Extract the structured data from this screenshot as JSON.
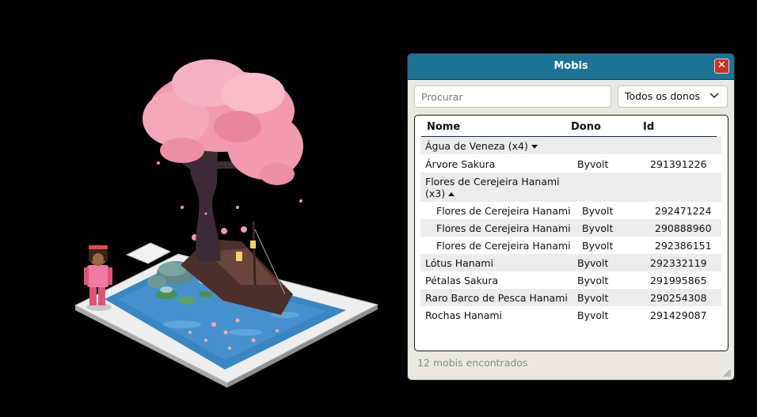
{
  "window": {
    "title": "Mobis",
    "close_glyph": "✕",
    "search_placeholder": "Procurar",
    "filter_selected": "Todos os donos",
    "columns": {
      "name": "Nome",
      "owner": "Dono",
      "id": "Id"
    },
    "rows": {
      "r0": {
        "name": "Água de Veneza (x4)"
      },
      "r1": {
        "name": "Árvore Sakura",
        "owner": "Byvolt",
        "id": "291391226"
      },
      "r2": {
        "name": "Flores de Cerejeira Hanami (x3)"
      },
      "r3": {
        "name": "Flores de Cerejeira Hanami",
        "owner": "Byvolt",
        "id": "292471224"
      },
      "r4": {
        "name": "Flores de Cerejeira Hanami",
        "owner": "Byvolt",
        "id": "290888960"
      },
      "r5": {
        "name": "Flores de Cerejeira Hanami",
        "owner": "Byvolt",
        "id": "292386151"
      },
      "r6": {
        "name": "Lótus Hanami",
        "owner": "Byvolt",
        "id": "292332119"
      },
      "r7": {
        "name": "Pétalas Sakura",
        "owner": "Byvolt",
        "id": "291995865"
      },
      "r8": {
        "name": "Raro Barco de Pesca Hanami",
        "owner": "Byvolt",
        "id": "290254308"
      },
      "r9": {
        "name": "Rochas Hanami",
        "owner": "Byvolt",
        "id": "291429087"
      }
    },
    "footer": "12 mobis encontrados"
  },
  "colors": {
    "titlebar": "#1e7295",
    "close": "#c2352b",
    "panel": "#e9e8e2",
    "water": "#3a86c2",
    "blossom": "#f29ab0"
  },
  "icons": {
    "close": "close-icon",
    "dropdown": "chevron-down-icon",
    "expand": "caret-down-icon",
    "collapse": "caret-up-icon",
    "resize": "resize-grip-icon"
  }
}
